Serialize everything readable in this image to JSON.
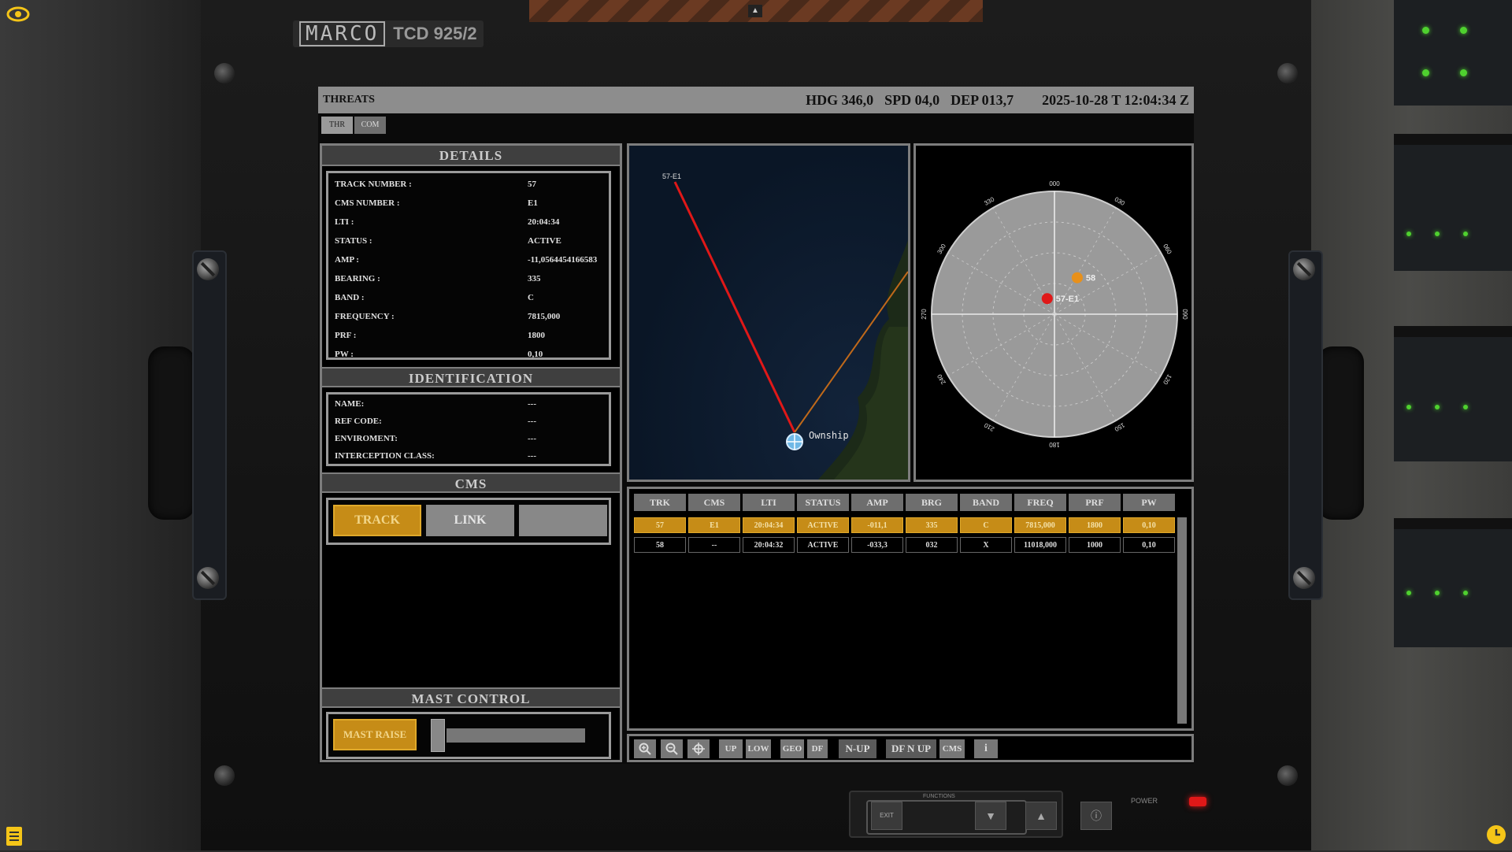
{
  "device": {
    "brand": "MARCO",
    "model": "TCD 925/2"
  },
  "header": {
    "title": "THREATS",
    "hdg": "HDG 346,0",
    "spd": "SPD 04,0",
    "dep": "DEP 013,7",
    "datetime": "2025-10-28 T 12:04:34 Z"
  },
  "tabs": [
    "THR",
    "COM"
  ],
  "details": {
    "heading": "DETAILS",
    "rows": [
      {
        "label": "TRACK NUMBER :",
        "value": "57"
      },
      {
        "label": "CMS NUMBER :",
        "value": "E1"
      },
      {
        "label": "LTI :",
        "value": "20:04:34"
      },
      {
        "label": "STATUS :",
        "value": "ACTIVE"
      },
      {
        "label": "AMP :",
        "value": "-11,0564454166583"
      },
      {
        "label": "BEARING :",
        "value": "335"
      },
      {
        "label": "BAND :",
        "value": "C"
      },
      {
        "label": "FREQUENCY :",
        "value": "7815,000"
      },
      {
        "label": "PRF :",
        "value": "1800"
      },
      {
        "label": "PW :",
        "value": "0,10"
      }
    ]
  },
  "identification": {
    "heading": "IDENTIFICATION",
    "rows": [
      {
        "label": "NAME:",
        "value": "---"
      },
      {
        "label": "REF CODE:",
        "value": "---"
      },
      {
        "label": "ENVIROMENT:",
        "value": "---"
      },
      {
        "label": "INTERCEPTION CLASS:",
        "value": "---"
      }
    ]
  },
  "cms": {
    "heading": "CMS",
    "track": "TRACK",
    "link": "LINK",
    "third": ""
  },
  "mast": {
    "heading": "MAST CONTROL",
    "button": "MAST RAISE",
    "level": 0.0
  },
  "map": {
    "ownship_label": "Ownship",
    "track_label": "57-E1"
  },
  "polar": {
    "ring_labels": [
      "000",
      "030",
      "060",
      "090",
      "120",
      "150",
      "180",
      "210",
      "240",
      "270",
      "300",
      "330"
    ],
    "contacts": [
      {
        "label": "58",
        "bearing": 32,
        "range": 0.35,
        "color": "#e8901a"
      },
      {
        "label": "57-E1",
        "bearing": 335,
        "range": 0.14,
        "color": "#e01818"
      }
    ]
  },
  "table": {
    "columns": [
      "TRK",
      "CMS",
      "LTI",
      "STATUS",
      "AMP",
      "BRG",
      "BAND",
      "FREQ",
      "PRF",
      "PW"
    ],
    "rows": [
      [
        "57",
        "E1",
        "20:04:34",
        "ACTIVE",
        "-011,1",
        "335",
        "C",
        "7815,000",
        "1800",
        "0,10"
      ],
      [
        "58",
        "--",
        "20:04:32",
        "ACTIVE",
        "-033,3",
        "032",
        "X",
        "11018,000",
        "1000",
        "0,10"
      ]
    ]
  },
  "toolbar": {
    "up": "UP",
    "low": "LOW",
    "geo": "GEO",
    "df": "DF",
    "nup": "N-UP",
    "dfnup": "DF N UP",
    "cms": "CMS",
    "info": "i"
  },
  "functions": {
    "label": "FUNCTIONS",
    "exit": "EXIT",
    "power": "POWER"
  },
  "colors": {
    "accent": "#c68c17",
    "threat": "#e01818",
    "contact": "#e8901a",
    "led": "#4fd12f"
  }
}
